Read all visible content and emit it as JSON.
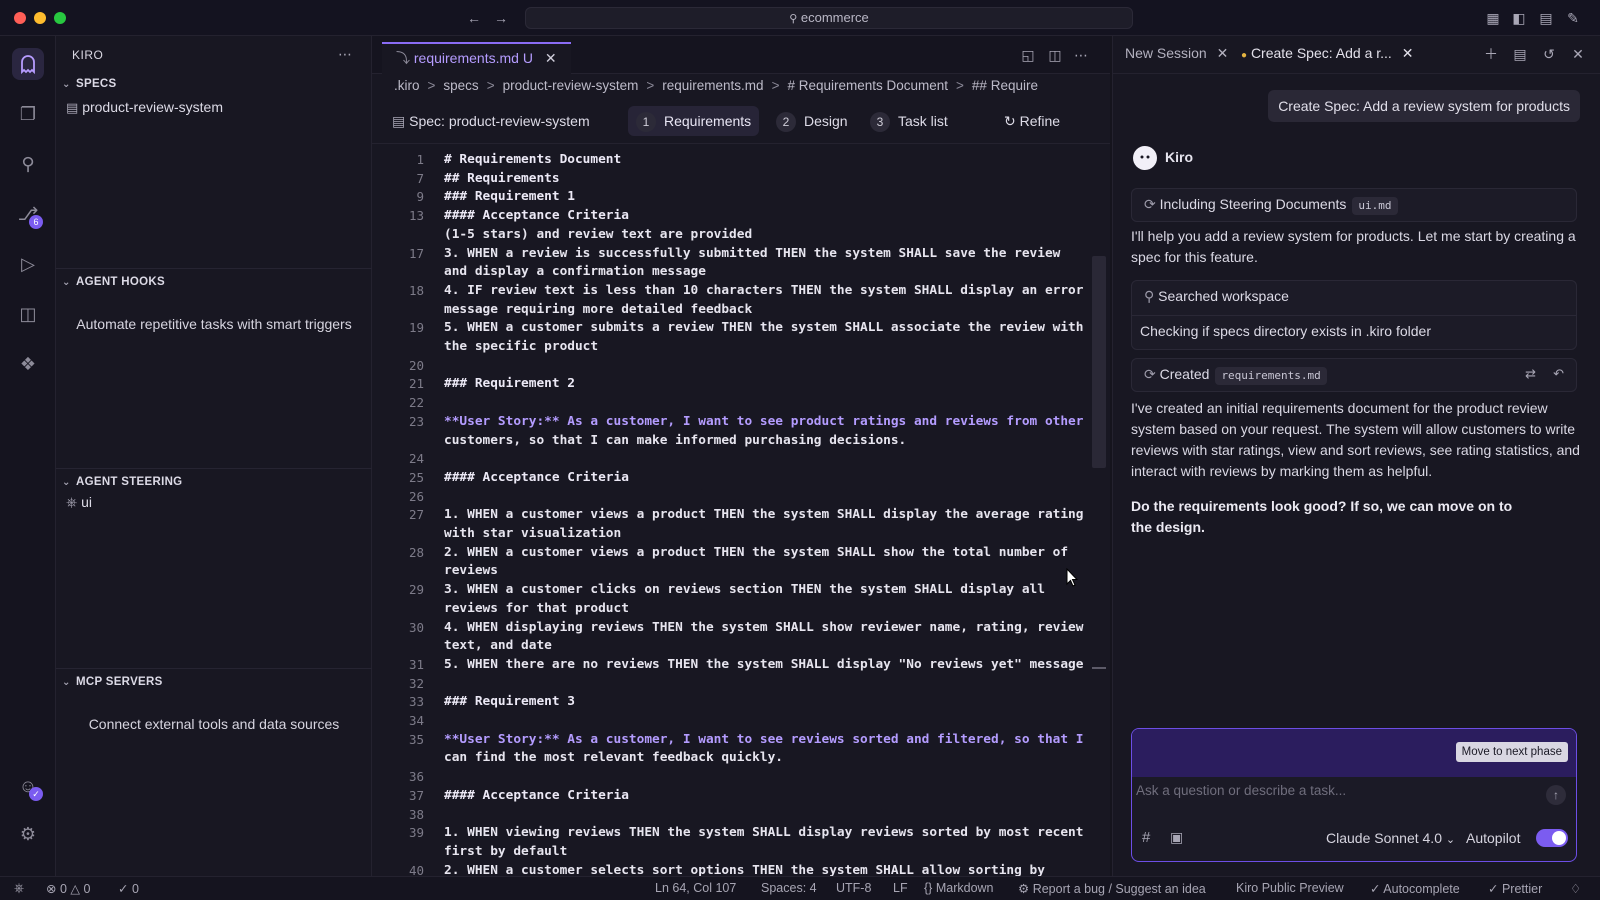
{
  "window": {
    "search": "ecommerce"
  },
  "sidebar": {
    "title": "KIRO",
    "specs_title": "SPECS",
    "spec_item": "product-review-system",
    "hooks_title": "AGENT HOOKS",
    "hooks_desc": "Automate repetitive tasks with smart triggers",
    "steering_title": "AGENT STEERING",
    "steering_item": "ui",
    "mcp_title": "MCP SERVERS",
    "mcp_desc": "Connect external tools and data sources"
  },
  "activity": {
    "scm_badge": "6"
  },
  "editor": {
    "tab_label": "requirements.md",
    "tab_status": "U",
    "breadcrumb": [
      ".kiro",
      ">",
      "specs",
      ">",
      "product-review-system",
      ">",
      "requirements.md",
      ">",
      "# Requirements Document",
      ">",
      "## Require"
    ],
    "spec_label": "Spec: product-review-system",
    "phases": [
      {
        "n": "1",
        "label": "Requirements"
      },
      {
        "n": "2",
        "label": "Design"
      },
      {
        "n": "3",
        "label": "Task list"
      }
    ],
    "refine": "Refine",
    "lines": [
      {
        "n": "1",
        "t": "# Requirements Document"
      },
      {
        "n": "7",
        "t": "## Requirements"
      },
      {
        "n": "9",
        "t": "### Requirement 1"
      },
      {
        "n": "13",
        "t": "#### Acceptance Criteria"
      },
      {
        "n": "",
        "t": "(1-5 stars) and review text are provided"
      },
      {
        "n": "17",
        "t": "3. WHEN a review is successfully submitted THEN the system SHALL save the review"
      },
      {
        "n": "",
        "t": "and display a confirmation message"
      },
      {
        "n": "18",
        "t": "4. IF review text is less than 10 characters THEN the system SHALL display an error"
      },
      {
        "n": "",
        "t": "message requiring more detailed feedback"
      },
      {
        "n": "19",
        "t": "5. WHEN a customer submits a review THEN the system SHALL associate the review with"
      },
      {
        "n": "",
        "t": "the specific product"
      },
      {
        "n": "20",
        "t": ""
      },
      {
        "n": "21",
        "t": "### Requirement 2"
      },
      {
        "n": "22",
        "t": ""
      },
      {
        "n": "23",
        "t": "**User Story:** As a customer, I want to see product ratings and reviews from other"
      },
      {
        "n": "",
        "t": "customers, so that I can make informed purchasing decisions."
      },
      {
        "n": "24",
        "t": ""
      },
      {
        "n": "25",
        "t": "#### Acceptance Criteria"
      },
      {
        "n": "26",
        "t": ""
      },
      {
        "n": "27",
        "t": "1. WHEN a customer views a product THEN the system SHALL display the average rating"
      },
      {
        "n": "",
        "t": "with star visualization"
      },
      {
        "n": "28",
        "t": "2. WHEN a customer views a product THEN the system SHALL show the total number of"
      },
      {
        "n": "",
        "t": "reviews"
      },
      {
        "n": "29",
        "t": "3. WHEN a customer clicks on reviews section THEN the system SHALL display all"
      },
      {
        "n": "",
        "t": "reviews for that product"
      },
      {
        "n": "30",
        "t": "4. WHEN displaying reviews THEN the system SHALL show reviewer name, rating, review"
      },
      {
        "n": "",
        "t": "text, and date"
      },
      {
        "n": "31",
        "t": "5. WHEN there are no reviews THEN the system SHALL display \"No reviews yet\" message"
      },
      {
        "n": "32",
        "t": ""
      },
      {
        "n": "33",
        "t": "### Requirement 3"
      },
      {
        "n": "34",
        "t": ""
      },
      {
        "n": "35",
        "t": "**User Story:** As a customer, I want to see reviews sorted and filtered, so that I"
      },
      {
        "n": "",
        "t": "can find the most relevant feedback quickly."
      },
      {
        "n": "36",
        "t": ""
      },
      {
        "n": "37",
        "t": "#### Acceptance Criteria"
      },
      {
        "n": "38",
        "t": ""
      },
      {
        "n": "39",
        "t": "1. WHEN viewing reviews THEN the system SHALL display reviews sorted by most recent"
      },
      {
        "n": "",
        "t": "first by default"
      },
      {
        "n": "40",
        "t": "2. WHEN a customer selects sort options THEN the system SHALL allow sorting by"
      }
    ]
  },
  "chat": {
    "tabs": [
      "New Session",
      "Create Spec: Add a r..."
    ],
    "user_message": "Create Spec: Add a review system for products",
    "agent_name": "Kiro",
    "steering_label": "Including Steering Documents",
    "steering_chip": "ui.md",
    "intro": "I'll help you add a review system for products. Let me start by creating a spec for this feature.",
    "search_label": "Searched workspace",
    "search_detail": "Checking if specs directory exists in .kiro folder",
    "created_label": "Created",
    "created_chip": "requirements.md",
    "summary": "I've created an initial requirements document for the product review system based on your request. The system will allow customers to write reviews with star ratings, view and sort reviews, see rating statistics, and interact with reviews by marking them as helpful.",
    "question": "Do the requirements look good? If so, we can move on to the design.",
    "next_phase": "Move to next phase",
    "input_placeholder": "Ask a question or describe a task...",
    "model": "Claude Sonnet 4.0",
    "autopilot": "Autopilot"
  },
  "status": {
    "errors": "0",
    "warnings": "0",
    "ports": "0",
    "position": "Ln 64, Col 107",
    "spaces": "Spaces: 4",
    "encoding": "UTF-8",
    "eol": "LF",
    "language": "Markdown",
    "report": "Report a bug / Suggest an idea",
    "preview": "Kiro Public Preview",
    "autocomplete": "Autocomplete",
    "prettier": "Prettier"
  },
  "colors": {
    "accent": "#7b5cf0",
    "bg": "#181722"
  }
}
